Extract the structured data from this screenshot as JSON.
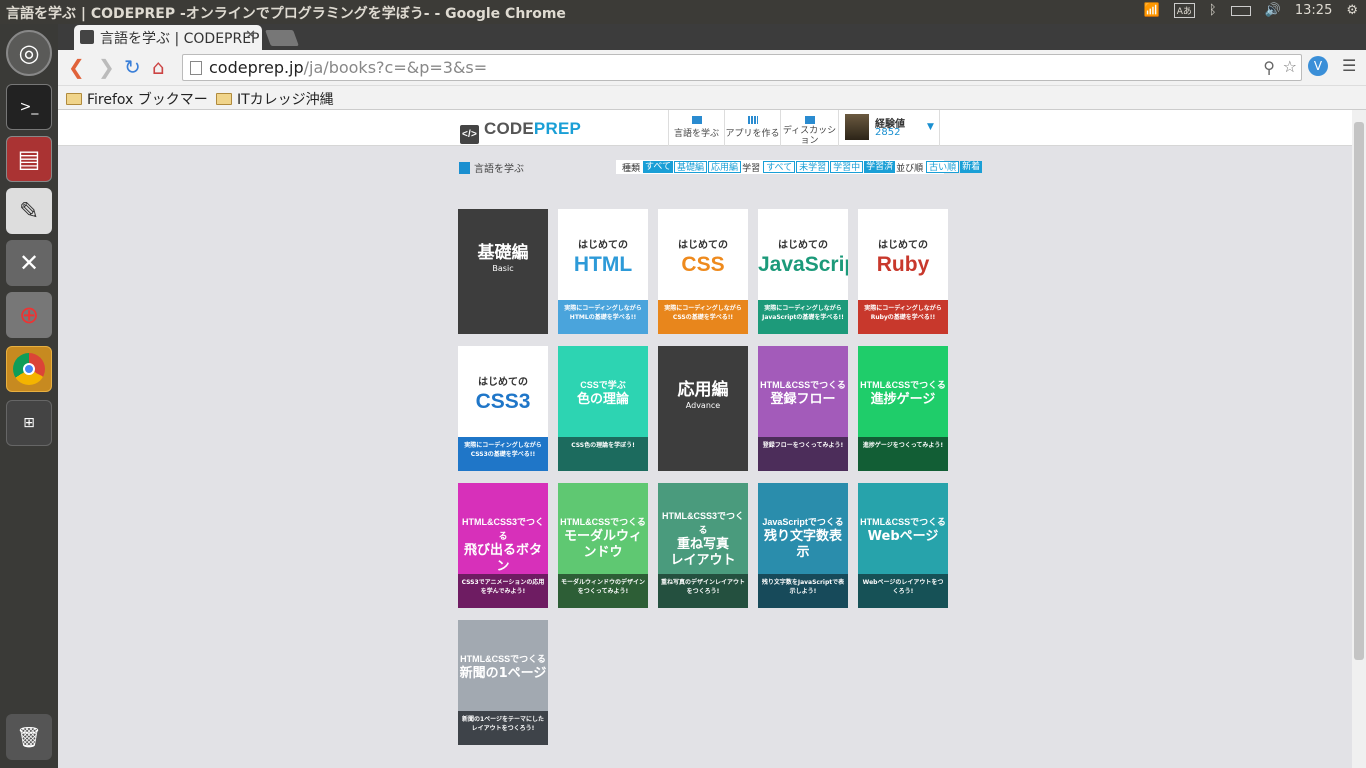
{
  "topbar": {
    "window_title": "言語を学ぶ | CODEPREP -オンラインでプログラミングを学ぼう- - Google Chrome",
    "clock": "13:25",
    "icons": [
      "wifi-icon",
      "keyboard-icon",
      "bluetooth-icon",
      "battery-icon",
      "volume-icon",
      "gear-icon"
    ]
  },
  "launcher": {
    "items": [
      "ubuntu-dash-icon",
      "terminal-icon",
      "file-manager-icon",
      "text-editor-icon",
      "settings-icon",
      "screenshot-icon",
      "chrome-icon",
      "workspaces-icon",
      "trash-icon"
    ]
  },
  "browser": {
    "tab_title": "言語を学ぶ | CODEPREP",
    "url_host": "codeprep.jp",
    "url_path": "/ja/books?c=&p=3&s=",
    "bookmarks": [
      "Firefox ブックマー",
      "ITカレッジ沖縄"
    ]
  },
  "site": {
    "logo_left": "CODE",
    "logo_right": "PREP",
    "nav": [
      "言語を学ぶ",
      "アプリを作る",
      "ディスカッション"
    ],
    "user_label": "経験値",
    "user_value": "2852",
    "breadcrumb": "言語を学ぶ",
    "filters": {
      "kind_label": "種類",
      "kind": [
        "すべて",
        "基礎編",
        "応用編"
      ],
      "study_label": "学習",
      "study": [
        "すべて",
        "未学習",
        "学習中",
        "学習済"
      ],
      "order_label": "並び順",
      "order": [
        "古い順",
        "新着"
      ]
    },
    "colors": {
      "accent": "#1a9fd6"
    }
  },
  "cards": [
    {
      "pre": "",
      "title": "基礎編",
      "sub": "Basic",
      "desc": "",
      "top": "#3d3d3d",
      "bot": "#3d3d3d",
      "fg": "#ffffff",
      "titlecolor": "#ffffff"
    },
    {
      "pre": "はじめての",
      "title": "HTML",
      "desc": "実際にコーディングしながらHTMLの基礎を学べる!!",
      "top": "#ffffff",
      "bot": "#4aa4dc",
      "fg": "#333333",
      "titlecolor": "#2d9ad8"
    },
    {
      "pre": "はじめての",
      "title": "CSS",
      "desc": "実際にコーディングしながらCSSの基礎を学べる!!",
      "top": "#ffffff",
      "bot": "#e8861c",
      "fg": "#333333",
      "titlecolor": "#ee8a1d"
    },
    {
      "pre": "はじめての",
      "title": "JavaScript",
      "desc": "実際にコーディングしながらJavaScriptの基礎を学べる!!",
      "top": "#ffffff",
      "bot": "#1d9a7a",
      "fg": "#333333",
      "titlecolor": "#1c9a7a"
    },
    {
      "pre": "はじめての",
      "title": "Ruby",
      "desc": "実際にコーディングしながらRubyの基礎を学べる!!",
      "top": "#ffffff",
      "bot": "#c8382c",
      "fg": "#333333",
      "titlecolor": "#c8382c"
    },
    {
      "pre": "はじめての",
      "title": "CSS3",
      "desc": "実際にコーディングしながらCSS3の基礎を学べる!!",
      "top": "#ffffff",
      "bot": "#1f76c8",
      "fg": "#333333",
      "titlecolor": "#1f76c8"
    },
    {
      "pre": "CSSで学ぶ",
      "title": "色の理論",
      "desc": "CSS色の理論を学ぼう!",
      "top": "#2dd4b2",
      "bot": "#1c6b5e",
      "fg": "#ffffff",
      "titlecolor": "#ffffff"
    },
    {
      "pre": "",
      "title": "応用編",
      "sub": "Advance",
      "desc": "",
      "top": "#3d3d3d",
      "bot": "#3d3d3d",
      "fg": "#ffffff",
      "titlecolor": "#ffffff"
    },
    {
      "pre": "HTML&CSSでつくる",
      "title": "登録フロー",
      "desc": "登録フローをつくってみよう!",
      "top": "#a35bba",
      "bot": "#4c2d5a",
      "fg": "#ffffff",
      "titlecolor": "#ffffff"
    },
    {
      "pre": "HTML&CSSでつくる",
      "title": "進捗ゲージ",
      "desc": "進捗ゲージをつくってみよう!",
      "top": "#1fcd6a",
      "bot": "#125e35",
      "fg": "#ffffff",
      "titlecolor": "#ffffff"
    },
    {
      "pre": "HTML&CSS3でつくる",
      "title": "飛び出るボタン",
      "desc": "CSS3でアニメーションの応用を学んでみよう!",
      "top": "#d730ba",
      "bot": "#6e1c62",
      "fg": "#ffffff",
      "titlecolor": "#ffffff"
    },
    {
      "pre": "HTML&CSSでつくる",
      "title": "モーダルウィンドウ",
      "desc": "モーダルウィンドウのデザインをつくってみよう!",
      "top": "#5fc872",
      "bot": "#2d5e36",
      "fg": "#ffffff",
      "titlecolor": "#ffffff"
    },
    {
      "pre": "HTML&CSS3でつくる",
      "title": "重ね写真\nレイアウト",
      "desc": "重ね写真のデザインレイアウトをつくろう!",
      "top": "#4a9b7d",
      "bot": "#24503f",
      "fg": "#ffffff",
      "titlecolor": "#ffffff"
    },
    {
      "pre": "JavaScriptでつくる",
      "title": "残り文字数表示",
      "desc": "残り文字数をJavaScriptで表示しよう!",
      "top": "#2a8dac",
      "bot": "#174a5a",
      "fg": "#ffffff",
      "titlecolor": "#ffffff"
    },
    {
      "pre": "HTML&CSSでつくる",
      "title": "Webページ",
      "desc": "Webページのレイアウトをつくろう!",
      "top": "#27a3ab",
      "bot": "#165156",
      "fg": "#ffffff",
      "titlecolor": "#ffffff"
    },
    {
      "pre": "HTML&CSSでつくる",
      "title": "新聞の1ページ",
      "desc": "新聞の1ページをテーマにしたレイアウトをつくろう!",
      "top": "#a2a9b1",
      "bot": "#3e4349",
      "fg": "#ffffff",
      "titlecolor": "#ffffff"
    }
  ]
}
